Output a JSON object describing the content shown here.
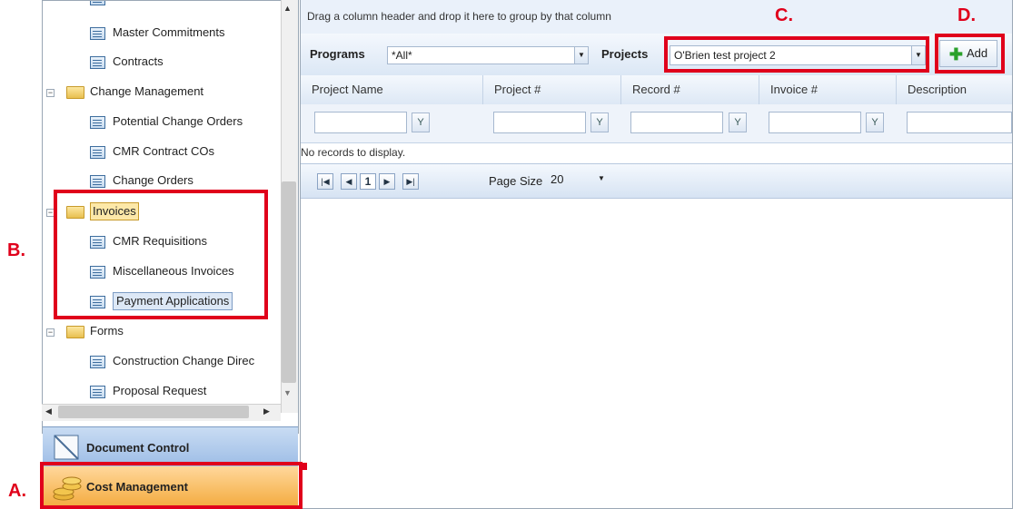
{
  "tree": {
    "items": [
      {
        "label": "Master Commitments",
        "kind": "doc"
      },
      {
        "label": "Contracts",
        "kind": "doc"
      },
      {
        "label": "Change Management",
        "kind": "folder"
      },
      {
        "label": "Potential Change Orders",
        "kind": "doc"
      },
      {
        "label": "CMR Contract COs",
        "kind": "doc"
      },
      {
        "label": "Change Orders",
        "kind": "doc"
      },
      {
        "label": "Invoices",
        "kind": "folder"
      },
      {
        "label": "CMR Requisitions",
        "kind": "doc"
      },
      {
        "label": "Miscellaneous Invoices",
        "kind": "doc"
      },
      {
        "label": "Payment Applications",
        "kind": "doc"
      },
      {
        "label": "Forms",
        "kind": "folder"
      },
      {
        "label": "Construction Change Direc",
        "kind": "doc"
      },
      {
        "label": "Proposal Request",
        "kind": "doc"
      }
    ],
    "expander_minus": "−"
  },
  "nav": {
    "document_control": "Document Control",
    "cost_management": "Cost Management"
  },
  "main": {
    "group_hint": "Drag a column header and drop it here to group by that column",
    "programs_label": "Programs",
    "programs_value": "*All*",
    "projects_label": "Projects",
    "projects_value": "O'Brien test project 2",
    "add_label": "Add",
    "columns": [
      "Project Name",
      "Project #",
      "Record #",
      "Invoice #",
      "Description"
    ],
    "no_records": "No records to display.",
    "pager": {
      "first": "|◀",
      "prev": "◀",
      "page": "1",
      "next": "▶",
      "last": "▶|",
      "page_size_label": "Page Size",
      "page_size_value": "20"
    }
  },
  "callouts": {
    "a": "A.",
    "b": "B.",
    "c": "C.",
    "d": "D."
  },
  "icons": {
    "filter": "filter-icon",
    "dropdown": "chevron-down-icon",
    "add": "plus-icon"
  },
  "colors": {
    "callout": "#e0001b",
    "cost_nav": "#f3a93a",
    "doc_nav": "#9dbde6"
  }
}
